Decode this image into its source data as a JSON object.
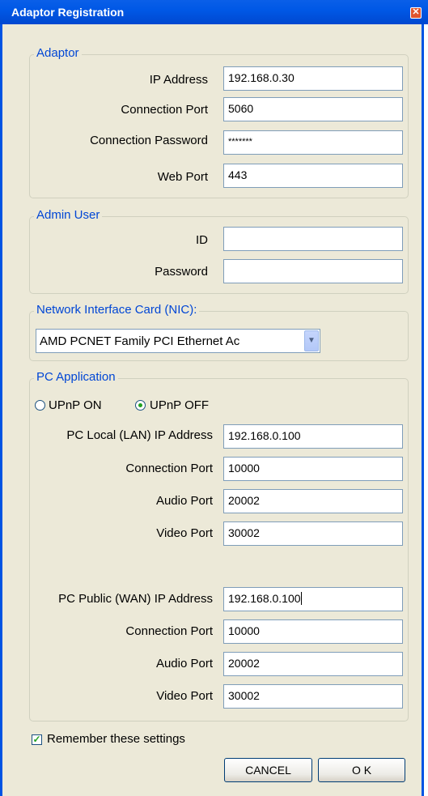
{
  "window": {
    "title": "Adaptor Registration"
  },
  "adaptor": {
    "legend": "Adaptor",
    "ip_label": "IP Address",
    "ip_value": "192.168.0.30",
    "port_label": "Connection Port",
    "port_value": "5060",
    "password_label": "Connection Password",
    "password_value": "*******",
    "web_port_label": "Web Port",
    "web_port_value": "443"
  },
  "admin": {
    "legend": "Admin User",
    "id_label": "ID",
    "id_value": "",
    "password_label": "Password",
    "password_value": ""
  },
  "nic": {
    "legend": "Network Interface Card (NIC):",
    "selected": "AMD PCNET Family PCI Ethernet Ac"
  },
  "pc_app": {
    "legend": "PC Application",
    "upnp_on_label": "UPnP ON",
    "upnp_off_label": "UPnP OFF",
    "upnp_selected": "off",
    "lan": {
      "ip_label": "PC Local (LAN) IP Address",
      "ip_value": "192.168.0.100",
      "port_label": "Connection Port",
      "port_value": "10000",
      "audio_label": "Audio Port",
      "audio_value": "20002",
      "video_label": "Video Port",
      "video_value": "30002"
    },
    "wan": {
      "ip_label": "PC Public (WAN) IP Address",
      "ip_value": "192.168.0.100",
      "port_label": "Connection Port",
      "port_value": "10000",
      "audio_label": "Audio Port",
      "audio_value": "20002",
      "video_label": "Video Port",
      "video_value": "30002"
    }
  },
  "remember": {
    "label": "Remember these settings",
    "checked": true
  },
  "buttons": {
    "cancel": "CANCEL",
    "ok": "O K"
  },
  "colors": {
    "titlebar": "#0058e6",
    "dialog_bg": "#ece9d8",
    "legend_text": "#0046d5"
  }
}
